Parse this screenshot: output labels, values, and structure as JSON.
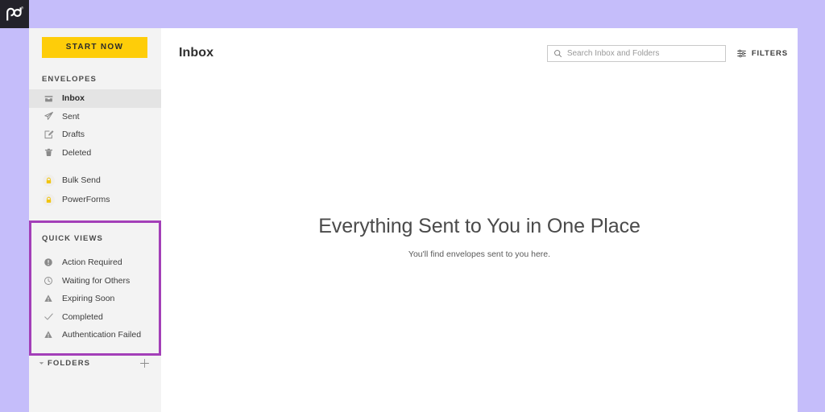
{
  "brand": {
    "logo_text": "pd",
    "logo_mark": "pandadoc-logo",
    "trademark": "®",
    "accent_yellow": "#fecd09",
    "highlight_purple": "#a33fb8",
    "page_background": "#c5bdfa",
    "sidebar_background": "#f3f3f3"
  },
  "sidebar": {
    "start_now_label": "START NOW",
    "envelopes_heading": "ENVELOPES",
    "envelopes": [
      {
        "label": "Inbox",
        "icon": "inbox-tray-icon",
        "active": true
      },
      {
        "label": "Sent",
        "icon": "paper-plane-icon",
        "active": false
      },
      {
        "label": "Drafts",
        "icon": "draft-pencil-icon",
        "active": false
      },
      {
        "label": "Deleted",
        "icon": "trash-icon",
        "active": false
      }
    ],
    "locked_items": [
      {
        "label": "Bulk Send",
        "icon": "lock-icon"
      },
      {
        "label": "PowerForms",
        "icon": "lock-icon"
      }
    ],
    "quick_views_heading": "QUICK VIEWS",
    "quick_views": [
      {
        "label": "Action Required",
        "icon": "exclamation-circle-icon"
      },
      {
        "label": "Waiting for Others",
        "icon": "clock-icon"
      },
      {
        "label": "Expiring Soon",
        "icon": "warning-triangle-icon"
      },
      {
        "label": "Completed",
        "icon": "check-icon"
      },
      {
        "label": "Authentication Failed",
        "icon": "warning-triangle-icon"
      }
    ],
    "folders_label": "FOLDERS",
    "folders_caret_icon": "caret-down-icon",
    "add_folder_icon": "plus-icon"
  },
  "header": {
    "page_title": "Inbox",
    "search_placeholder": "Search Inbox and Folders",
    "search_value": "",
    "search_icon": "search-icon",
    "filters_label": "FILTERS",
    "filters_icon": "sliders-icon"
  },
  "main": {
    "empty_title": "Everything Sent to You in One Place",
    "empty_subtitle": "You'll find envelopes sent to you here."
  }
}
